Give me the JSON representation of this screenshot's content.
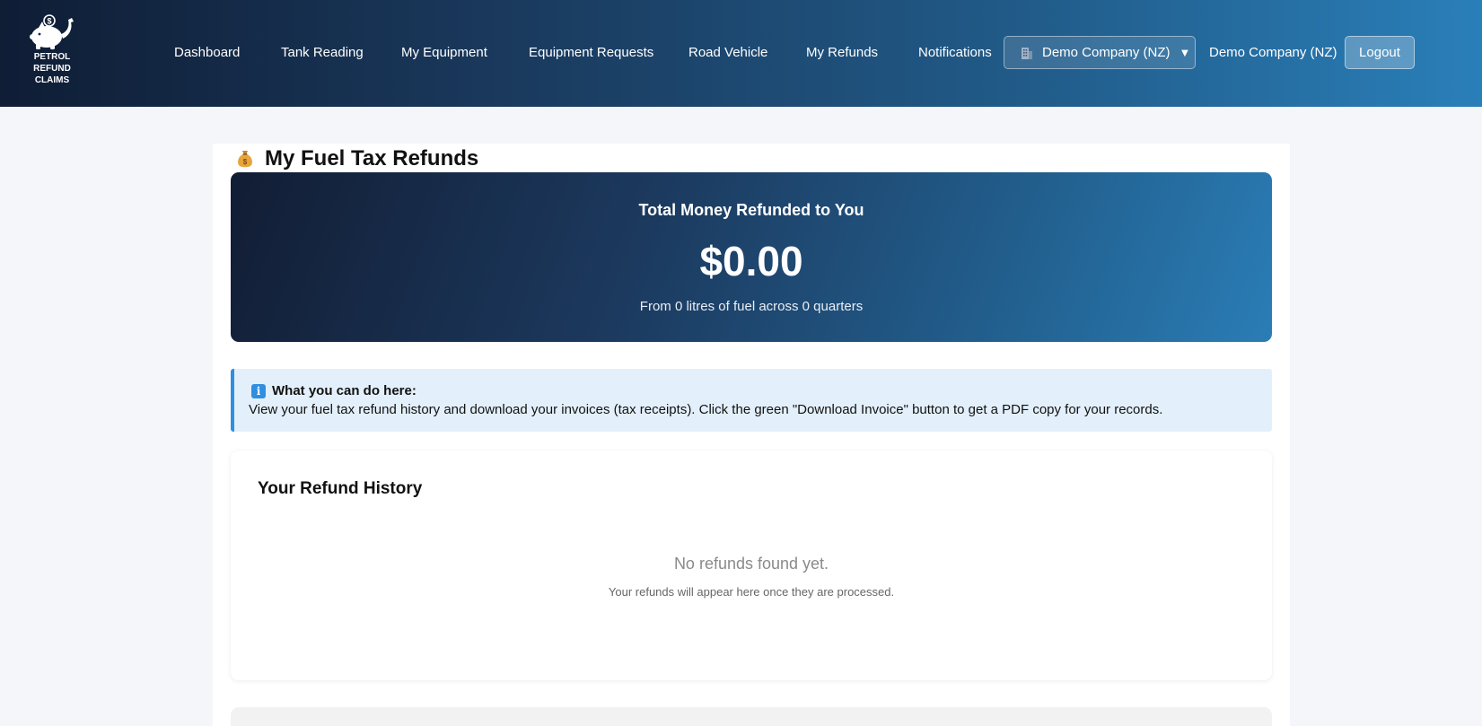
{
  "brand": {
    "logo_lines": [
      "PETROL",
      "REFUND",
      "CLAIMS"
    ],
    "logo_icon": "piggy-bank-fuel-icon"
  },
  "nav": {
    "items": [
      {
        "label": "Dashboard"
      },
      {
        "label": "Tank Reading"
      },
      {
        "label": "My Equipment"
      },
      {
        "label": "Equipment Requests"
      },
      {
        "label": "Road Vehicle"
      },
      {
        "label": "My Refunds"
      },
      {
        "label": "Notifications"
      }
    ],
    "company_selector": {
      "label": "Demo Company (NZ)",
      "icon": "building-icon"
    },
    "company_name": "Demo Company (NZ)",
    "logout_label": "Logout"
  },
  "page": {
    "title": "My Fuel Tax Refunds",
    "title_icon": "money-bag-icon"
  },
  "summary": {
    "label": "Total Money Refunded to You",
    "amount": "$0.00",
    "subtext": "From 0 litres of fuel across 0 quarters"
  },
  "info": {
    "heading": "What you can do here:",
    "body": "View your fuel tax refund history and download your invoices (tax receipts). Click the green \"Download Invoice\" button to get a PDF copy for your records."
  },
  "history": {
    "title": "Your Refund History",
    "empty_message": "No refunds found yet.",
    "empty_hint": "Your refunds will appear here once they are processed."
  },
  "colors": {
    "header_start": "#0f1d35",
    "header_end": "#2a7fb9",
    "info_bg": "#e3f0fb",
    "info_accent": "#2f8fe0"
  }
}
